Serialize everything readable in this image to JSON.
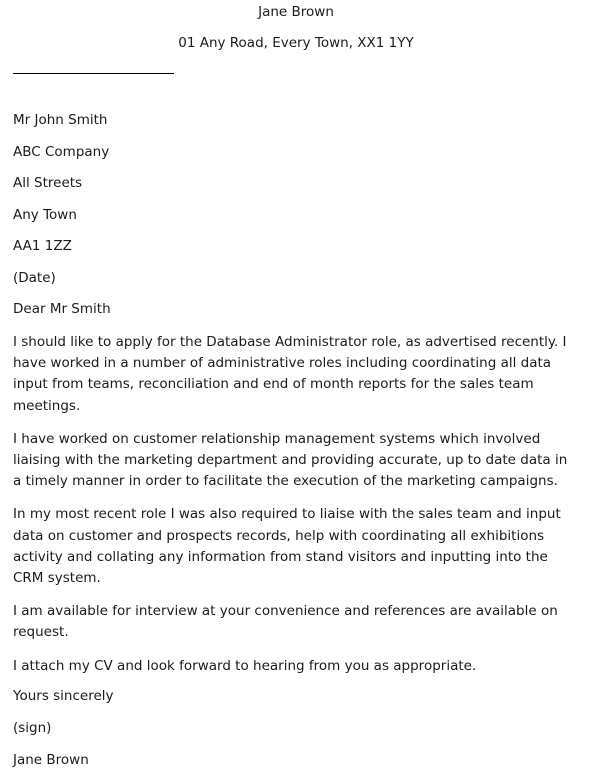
{
  "document": {
    "type": "cover-letter",
    "colors": {
      "page_background": "#ffffff",
      "text": "#1b1b1b",
      "rule": "#000000"
    },
    "sender": {
      "name": "Jane Brown",
      "address": "01 Any Road, Every Town, XX1 1YY"
    },
    "recipient": {
      "lines": [
        "Mr John Smith",
        "ABC Company",
        "All Streets",
        "Any Town",
        "AA1 1ZZ"
      ]
    },
    "date": "(Date)",
    "salutation": "Dear Mr Smith",
    "paragraphs": [
      "I should like to apply for the Database Administrator role, as advertised recently. I have worked in a number of administrative roles including coordinating all data input from teams, reconciliation and end of month reports for the sales team meetings.",
      "I have worked on customer relationship management systems which involved liaising with the marketing department and providing accurate, up to date data in a timely manner in order to facilitate the execution of the marketing campaigns.",
      "In my most recent role I was also required to liaise with the sales team and input data on customer and prospects records, help with coordinating all exhibitions activity and collating any information from stand visitors and inputting into the CRM system.",
      "I am available for interview at your convenience and references are available on request.",
      "I attach my CV and look forward to hearing from you as appropriate."
    ],
    "closing": {
      "valediction": "Yours sincerely",
      "signature_placeholder": "(sign)",
      "signer_name": "Jane Brown"
    }
  }
}
